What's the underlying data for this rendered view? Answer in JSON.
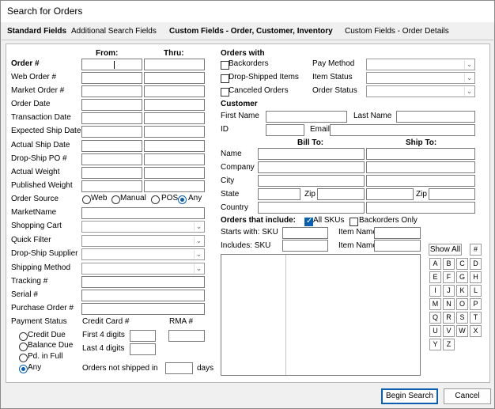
{
  "window": {
    "title": "Search for Orders"
  },
  "tabs": [
    "Standard Fields",
    "Additional Search Fields",
    "Custom Fields - Order, Customer, Inventory",
    "Custom Fields - Order Details"
  ],
  "left": {
    "from_header": "From:",
    "thru_header": "Thru:",
    "order_num": "Order #",
    "web_order": "Web Order #",
    "market_order": "Market Order #",
    "order_date": "Order Date",
    "transaction_date": "Transaction Date",
    "expected_ship": "Expected Ship Date",
    "actual_ship": "Actual Ship Date",
    "drop_ship_po": "Drop-Ship PO #",
    "actual_weight": "Actual Weight",
    "published_weight": "Published Weight",
    "order_source": "Order Source",
    "source_web": "Web",
    "source_manual": "Manual",
    "source_pos": "POS",
    "source_any": "Any",
    "market_name": "MarketName",
    "shopping_cart": "Shopping Cart",
    "quick_filter": "Quick Filter",
    "drop_ship_supplier": "Drop-Ship Supplier",
    "shipping_method": "Shipping Method",
    "tracking": "Tracking #",
    "serial": "Serial #",
    "purchase_order": "Purchase Order #",
    "payment_status": "Payment Status",
    "credit_card": "Credit Card #",
    "rma": "RMA #",
    "credit_due": "Credit Due",
    "balance_due": "Balance Due",
    "pd_in_full": "Pd. in Full",
    "any": "Any",
    "first4": "First 4 digits",
    "last4": "Last 4 digits",
    "not_shipped": "Orders not shipped in",
    "days": "days"
  },
  "right": {
    "orders_with": "Orders with",
    "backorders": "Backorders",
    "drop_shipped": "Drop-Shipped Items",
    "canceled": "Canceled Orders",
    "pay_method": "Pay Method",
    "item_status": "Item Status",
    "order_status": "Order Status",
    "customer": "Customer",
    "first_name": "First Name",
    "last_name": "Last Name",
    "id": "ID",
    "email": "Email",
    "bill_to": "Bill To:",
    "ship_to": "Ship To:",
    "name": "Name",
    "company": "Company",
    "city": "City",
    "state": "State",
    "zip": "Zip",
    "country": "Country",
    "orders_include": "Orders that include:",
    "all_skus": "All SKUs",
    "backorders_only": "Backorders Only",
    "starts_with": "Starts with: SKU",
    "includes": "Includes: SKU",
    "item_name": "Item Name",
    "show_all": "Show All",
    "letters": [
      "#",
      "A",
      "B",
      "C",
      "D",
      "E",
      "F",
      "G",
      "H",
      "I",
      "J",
      "K",
      "L",
      "M",
      "N",
      "O",
      "P",
      "Q",
      "R",
      "S",
      "T",
      "U",
      "V",
      "W",
      "X",
      "Y",
      "Z"
    ]
  },
  "footer": {
    "begin_search": "Begin Search",
    "cancel": "Cancel"
  }
}
